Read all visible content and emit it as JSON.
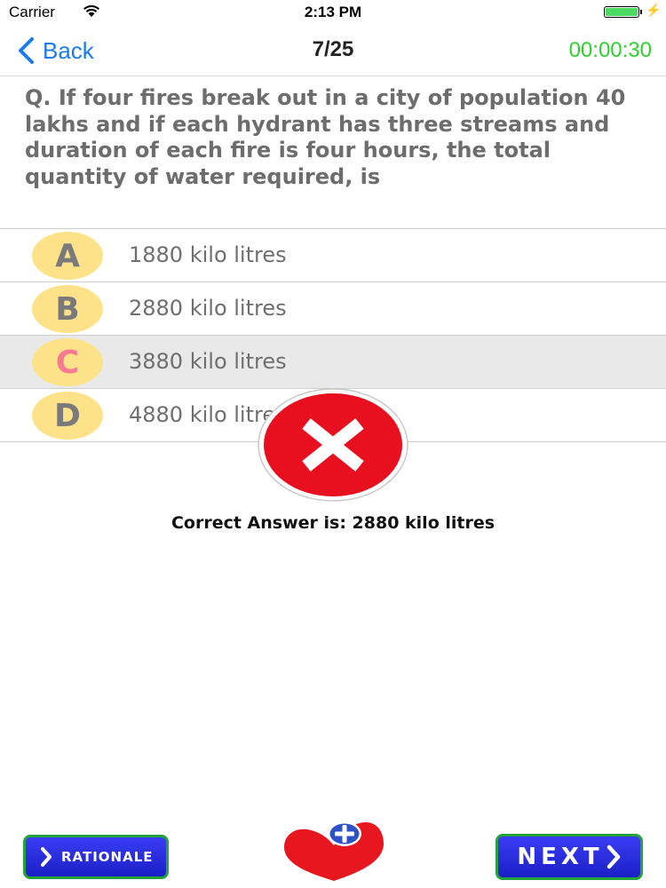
{
  "status_bar": {
    "carrier": "Carrier",
    "time": "2:13 PM"
  },
  "nav": {
    "back_label": "Back",
    "progress": "7/25",
    "timer": "00:00:30"
  },
  "question": {
    "text": "Q. If four fires break out in a city of population 40 lakhs and if each hydrant has three streams and duration of each fire is four hours, the total quantity of water required, is"
  },
  "options": [
    {
      "letter": "A",
      "text": "1880 kilo litres"
    },
    {
      "letter": "B",
      "text": "2880 kilo litres"
    },
    {
      "letter": "C",
      "text": "3880 kilo litres"
    },
    {
      "letter": "D",
      "text": "4880 kilo litres"
    }
  ],
  "selected_option": "C",
  "result": {
    "icon": "wrong-answer-icon",
    "correct_answer_text": "Correct Answer is:  2880 kilo litres"
  },
  "buttons": {
    "rationale_label": "RATIONALE",
    "next_label": "NEXT",
    "favorite_icon": "heart-plus-icon"
  },
  "colors": {
    "accent_blue": "#1a7cf2",
    "timer_green": "#2fd12f",
    "option_circle": "#fde28a",
    "selected_letter": "#f77a92",
    "wrong_red": "#e8101e",
    "button_blue": "#2326d8",
    "button_border": "#23a33a"
  }
}
